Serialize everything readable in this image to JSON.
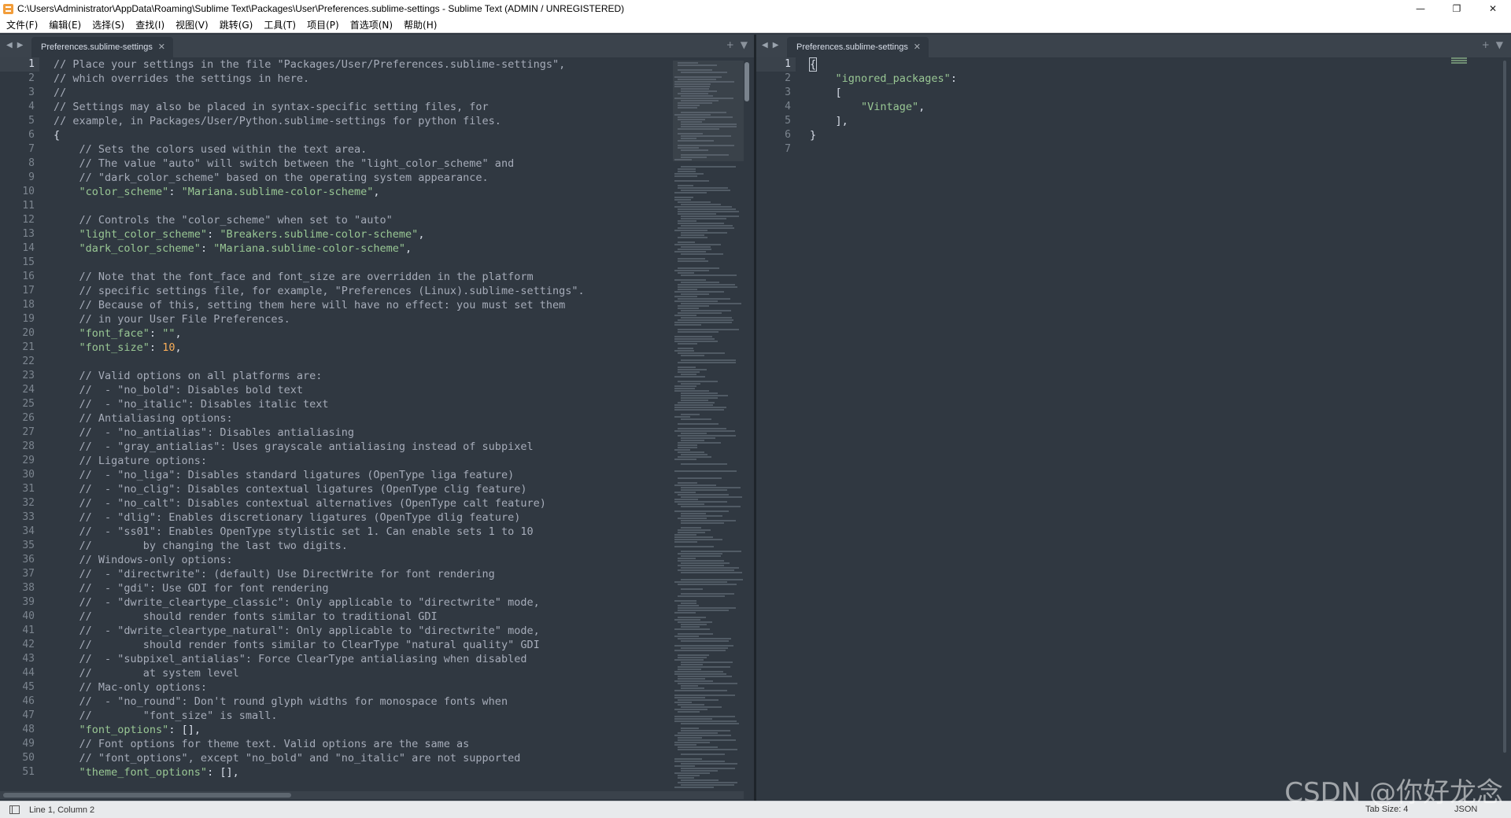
{
  "window": {
    "title": "C:\\Users\\Administrator\\AppData\\Roaming\\Sublime Text\\Packages\\User\\Preferences.sublime-settings - Sublime Text (ADMIN / UNREGISTERED)",
    "minimize_glyph": "—",
    "restore_glyph": "❐",
    "close_glyph": "✕"
  },
  "menu": [
    "文件(F)",
    "编辑(E)",
    "选择(S)",
    "查找(I)",
    "视图(V)",
    "跳转(G)",
    "工具(T)",
    "项目(P)",
    "首选项(N)",
    "帮助(H)"
  ],
  "left_pane": {
    "tab_label": "Preferences.sublime-settings",
    "lines": [
      [
        [
          "c",
          "// Place your settings in the file \"Packages/User/Preferences.sublime-settings\","
        ]
      ],
      [
        [
          "c",
          "// which overrides the settings in here."
        ]
      ],
      [
        [
          "c",
          "//"
        ]
      ],
      [
        [
          "c",
          "// Settings may also be placed in syntax-specific setting files, for"
        ]
      ],
      [
        [
          "c",
          "// example, in Packages/User/Python.sublime-settings for python files."
        ]
      ],
      [
        [
          "p",
          "{"
        ]
      ],
      [
        [
          "c",
          "    // Sets the colors used within the text area."
        ]
      ],
      [
        [
          "c",
          "    // The value \"auto\" will switch between the \"light_color_scheme\" and"
        ]
      ],
      [
        [
          "c",
          "    // \"dark_color_scheme\" based on the operating system appearance."
        ]
      ],
      [
        [
          "k",
          "    \"color_scheme\""
        ],
        [
          "p",
          ": "
        ],
        [
          "s",
          "\"Mariana.sublime-color-scheme\""
        ],
        [
          "p",
          ","
        ]
      ],
      [
        [
          "p",
          ""
        ]
      ],
      [
        [
          "c",
          "    // Controls the \"color_scheme\" when set to \"auto\""
        ]
      ],
      [
        [
          "k",
          "    \"light_color_scheme\""
        ],
        [
          "p",
          ": "
        ],
        [
          "s",
          "\"Breakers.sublime-color-scheme\""
        ],
        [
          "p",
          ","
        ]
      ],
      [
        [
          "k",
          "    \"dark_color_scheme\""
        ],
        [
          "p",
          ": "
        ],
        [
          "s",
          "\"Mariana.sublime-color-scheme\""
        ],
        [
          "p",
          ","
        ]
      ],
      [
        [
          "p",
          ""
        ]
      ],
      [
        [
          "c",
          "    // Note that the font_face and font_size are overridden in the platform"
        ]
      ],
      [
        [
          "c",
          "    // specific settings file, for example, \"Preferences (Linux).sublime-settings\"."
        ]
      ],
      [
        [
          "c",
          "    // Because of this, setting them here will have no effect: you must set them"
        ]
      ],
      [
        [
          "c",
          "    // in your User File Preferences."
        ]
      ],
      [
        [
          "k",
          "    \"font_face\""
        ],
        [
          "p",
          ": "
        ],
        [
          "s",
          "\"\""
        ],
        [
          "p",
          ","
        ]
      ],
      [
        [
          "k",
          "    \"font_size\""
        ],
        [
          "p",
          ": "
        ],
        [
          "n",
          "10"
        ],
        [
          "p",
          ","
        ]
      ],
      [
        [
          "p",
          ""
        ]
      ],
      [
        [
          "c",
          "    // Valid options on all platforms are:"
        ]
      ],
      [
        [
          "c",
          "    //  - \"no_bold\": Disables bold text"
        ]
      ],
      [
        [
          "c",
          "    //  - \"no_italic\": Disables italic text"
        ]
      ],
      [
        [
          "c",
          "    // Antialiasing options:"
        ]
      ],
      [
        [
          "c",
          "    //  - \"no_antialias\": Disables antialiasing"
        ]
      ],
      [
        [
          "c",
          "    //  - \"gray_antialias\": Uses grayscale antialiasing instead of subpixel"
        ]
      ],
      [
        [
          "c",
          "    // Ligature options:"
        ]
      ],
      [
        [
          "c",
          "    //  - \"no_liga\": Disables standard ligatures (OpenType liga feature)"
        ]
      ],
      [
        [
          "c",
          "    //  - \"no_clig\": Disables contextual ligatures (OpenType clig feature)"
        ]
      ],
      [
        [
          "c",
          "    //  - \"no_calt\": Disables contextual alternatives (OpenType calt feature)"
        ]
      ],
      [
        [
          "c",
          "    //  - \"dlig\": Enables discretionary ligatures (OpenType dlig feature)"
        ]
      ],
      [
        [
          "c",
          "    //  - \"ss01\": Enables OpenType stylistic set 1. Can enable sets 1 to 10"
        ]
      ],
      [
        [
          "c",
          "    //        by changing the last two digits."
        ]
      ],
      [
        [
          "c",
          "    // Windows-only options:"
        ]
      ],
      [
        [
          "c",
          "    //  - \"directwrite\": (default) Use DirectWrite for font rendering"
        ]
      ],
      [
        [
          "c",
          "    //  - \"gdi\": Use GDI for font rendering"
        ]
      ],
      [
        [
          "c",
          "    //  - \"dwrite_cleartype_classic\": Only applicable to \"directwrite\" mode,"
        ]
      ],
      [
        [
          "c",
          "    //        should render fonts similar to traditional GDI"
        ]
      ],
      [
        [
          "c",
          "    //  - \"dwrite_cleartype_natural\": Only applicable to \"directwrite\" mode,"
        ]
      ],
      [
        [
          "c",
          "    //        should render fonts similar to ClearType \"natural quality\" GDI"
        ]
      ],
      [
        [
          "c",
          "    //  - \"subpixel_antialias\": Force ClearType antialiasing when disabled"
        ]
      ],
      [
        [
          "c",
          "    //        at system level"
        ]
      ],
      [
        [
          "c",
          "    // Mac-only options:"
        ]
      ],
      [
        [
          "c",
          "    //  - \"no_round\": Don't round glyph widths for monospace fonts when"
        ]
      ],
      [
        [
          "c",
          "    //        \"font_size\" is small."
        ]
      ],
      [
        [
          "k",
          "    \"font_options\""
        ],
        [
          "p",
          ": [],"
        ]
      ],
      [
        [
          "c",
          "    // Font options for theme text. Valid options are the same as"
        ]
      ],
      [
        [
          "c",
          "    // \"font_options\", except \"no_bold\" and \"no_italic\" are not supported"
        ]
      ],
      [
        [
          "k",
          "    \"theme_font_options\""
        ],
        [
          "p",
          ": [],"
        ]
      ]
    ]
  },
  "right_pane": {
    "tab_label": "Preferences.sublime-settings",
    "lines": [
      [
        [
          "cur",
          "{"
        ]
      ],
      [
        [
          "k",
          "    \"ignored_packages\""
        ],
        [
          "p",
          ":"
        ]
      ],
      [
        [
          "p",
          "    ["
        ]
      ],
      [
        [
          "s",
          "        \"Vintage\""
        ],
        [
          "p",
          ","
        ]
      ],
      [
        [
          "p",
          "    ],"
        ]
      ],
      [
        [
          "p",
          "}"
        ]
      ],
      [
        [
          "p",
          ""
        ]
      ]
    ]
  },
  "status": {
    "position": "Line 1, Column 2",
    "tab_size": "Tab Size: 4",
    "syntax": "JSON"
  },
  "watermark": "CSDN @你好龙念",
  "colors": {
    "editor_bg": "#303841",
    "comment": "#a6acb9",
    "key": "#99c794",
    "string": "#99c794",
    "number": "#f9ae58"
  }
}
